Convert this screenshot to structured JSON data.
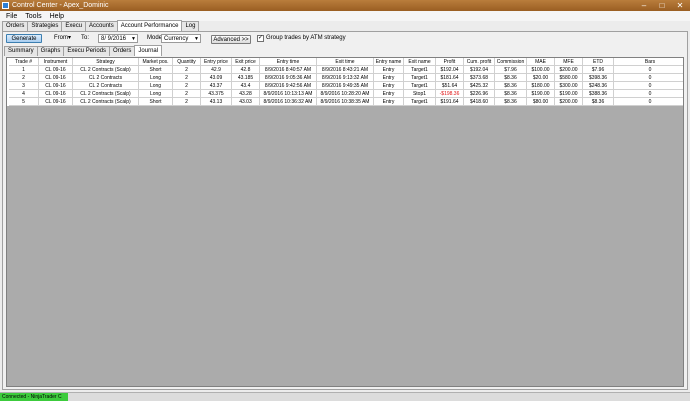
{
  "window": {
    "title": "Control Center - Apex_Dominic",
    "minimize": "–",
    "maximize": "□",
    "close": "✕"
  },
  "menu": [
    "File",
    "Tools",
    "Help"
  ],
  "main_tabs": [
    {
      "label": "Orders"
    },
    {
      "label": "Strategies"
    },
    {
      "label": "Execu"
    },
    {
      "label": "Accounts"
    },
    {
      "label": "Account Performance",
      "active": true
    },
    {
      "label": "Log"
    }
  ],
  "toolbar": {
    "generate_label": "Generate",
    "from_label": "From▾",
    "to_label": "To:",
    "to_value": "8/ 9/2016",
    "mode_label": "Mode:",
    "mode_value": "Currency",
    "advanced_label": "Advanced >>",
    "group_trades_label": "Group trades by ATM strategy",
    "group_trades_checked": "✓"
  },
  "sub_tabs": [
    {
      "label": "Summary"
    },
    {
      "label": "Graphs"
    },
    {
      "label": "Execu Periods"
    },
    {
      "label": "Orders"
    },
    {
      "label": "Journal",
      "active": true
    }
  ],
  "table": {
    "columns": [
      "Trade #",
      "Instrument",
      "Strategy",
      "Market pos.",
      "Quantity",
      "Entry price",
      "Exit price",
      "Entry time",
      "Exit time",
      "Entry name",
      "Exit name",
      "Profit",
      "Cum. profit",
      "Commission",
      "MAE",
      "MFE",
      "ETD",
      "Bars"
    ],
    "rows": [
      [
        "1",
        "CL 09-16",
        "CL 2 Contracts (Scalp)",
        "Short",
        "2",
        "42.9",
        "42.8",
        "8/9/2016 8:40:57 AM",
        "8/9/2016 8:43:21 AM",
        "Entry",
        "Target1",
        "$192.04",
        "$192.04",
        "$7.96",
        "$100.00",
        "$200.00",
        "$7.96",
        "0"
      ],
      [
        "2",
        "CL 09-16",
        "CL 2 Contracts",
        "Long",
        "2",
        "43.09",
        "43.185",
        "8/9/2016 9:05:36 AM",
        "8/9/2016 9:13:32 AM",
        "Entry",
        "Target1",
        "$181.64",
        "$373.68",
        "$8.36",
        "$20.00",
        "$580.00",
        "$398.36",
        "0"
      ],
      [
        "3",
        "CL 09-16",
        "CL 2 Contracts",
        "Long",
        "2",
        "43.37",
        "43.4",
        "8/9/2016 9:42:56 AM",
        "8/9/2016 9:49:35 AM",
        "Entry",
        "Target1",
        "$51.64",
        "$425.32",
        "$8.36",
        "$180.00",
        "$300.00",
        "$248.36",
        "0"
      ],
      [
        "4",
        "CL 09-16",
        "CL 2 Contracts (Scalp)",
        "Long",
        "2",
        "43.375",
        "43.28",
        "8/9/2016 10:13:13 AM",
        "8/9/2016 10:28:20 AM",
        "Entry",
        "Stop1",
        "-$198.36",
        "$226.96",
        "$8.36",
        "$190.00",
        "$190.00",
        "$388.36",
        "0"
      ],
      [
        "5",
        "CL 09-16",
        "CL 2 Contracts (Scalp)",
        "Short",
        "2",
        "43.13",
        "43.03",
        "8/9/2016 10:36:32 AM",
        "8/9/2016 10:38:35 AM",
        "Entry",
        "Target1",
        "$191.64",
        "$418.60",
        "$8.36",
        "$80.00",
        "$200.00",
        "$8.36",
        "0"
      ]
    ]
  },
  "status": {
    "connection": "Connected - NinjaTrader C",
    "connection_color": "#3ccb3c"
  },
  "colors": {
    "titlebar": "#a86a2c",
    "negative": "#e01010",
    "grid_bg": "#ababab"
  }
}
